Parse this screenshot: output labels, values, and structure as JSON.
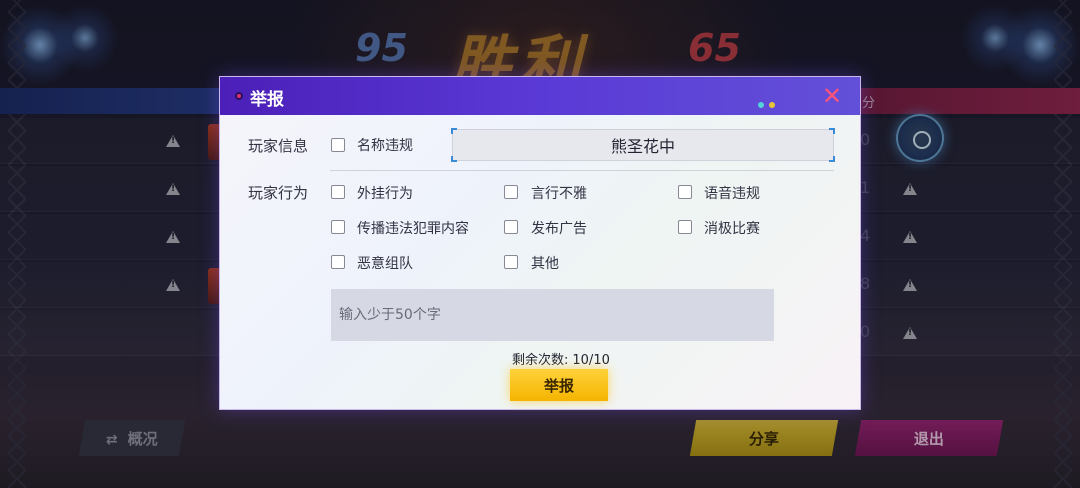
{
  "background": {
    "score_blue": "95",
    "score_red": "65",
    "result_title": "胜利",
    "red_bar_label": "分",
    "row_numbers": [
      "0",
      "1",
      "4",
      "8",
      "0"
    ],
    "buttons": {
      "overview": "概况",
      "share": "分享",
      "exit": "退出"
    }
  },
  "dialog": {
    "title": "举报",
    "player_info_label": "玩家信息",
    "name_violation_label": "名称违规",
    "player_name": "熊圣花中",
    "behavior_label": "玩家行为",
    "options": {
      "cheat": "外挂行为",
      "indecent": "言行不雅",
      "voice": "语音违规",
      "illegal_content": "传播违法犯罪内容",
      "ads": "发布广告",
      "passive": "消极比赛",
      "malicious_team": "恶意组队",
      "other": "其他"
    },
    "input_placeholder": "输入少于50个字",
    "remaining_label": "剩余次数:",
    "remaining_value": "10/10",
    "submit_label": "举报"
  },
  "colors": {
    "header_purple": "#5a3ad6",
    "close_pink": "#ff5478",
    "submit_yellow": "#ffd23a",
    "share_yellow": "#e6c83a",
    "exit_magenta": "#a0287a"
  }
}
